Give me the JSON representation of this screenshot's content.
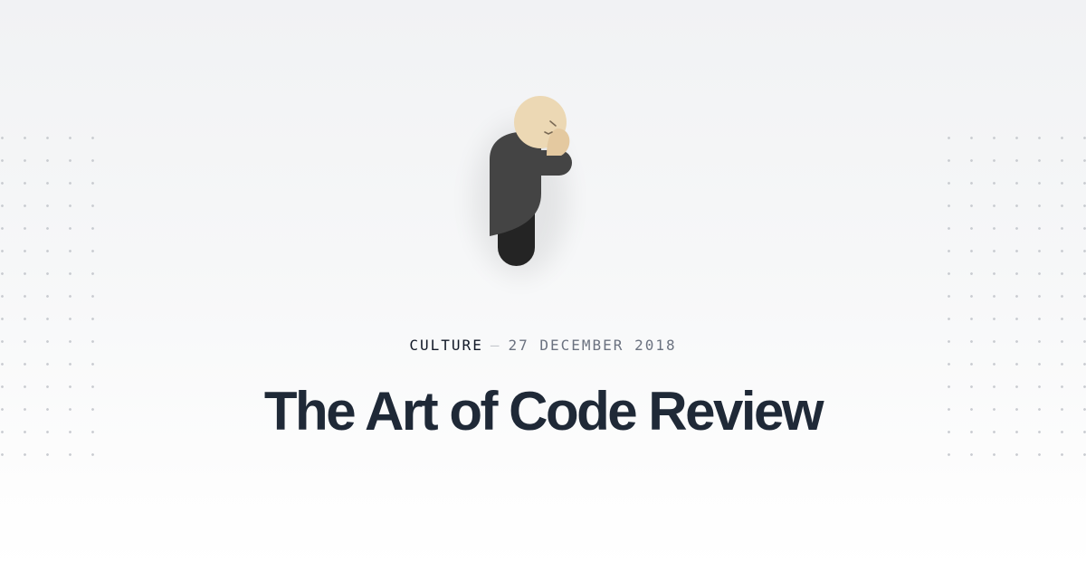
{
  "post": {
    "category": "CULTURE",
    "separator": "—",
    "date": "27 DECEMBER 2018",
    "title": "The Art of Code Review"
  },
  "illustration": {
    "icon": "facepalm-person-icon",
    "colors": {
      "skin": "#ecd8b4",
      "coat": "#444444",
      "legs": "#242424"
    }
  },
  "colors": {
    "title": "#1f2937",
    "category": "#111827",
    "date": "#6b7280",
    "dots": "#c9ccd1"
  }
}
